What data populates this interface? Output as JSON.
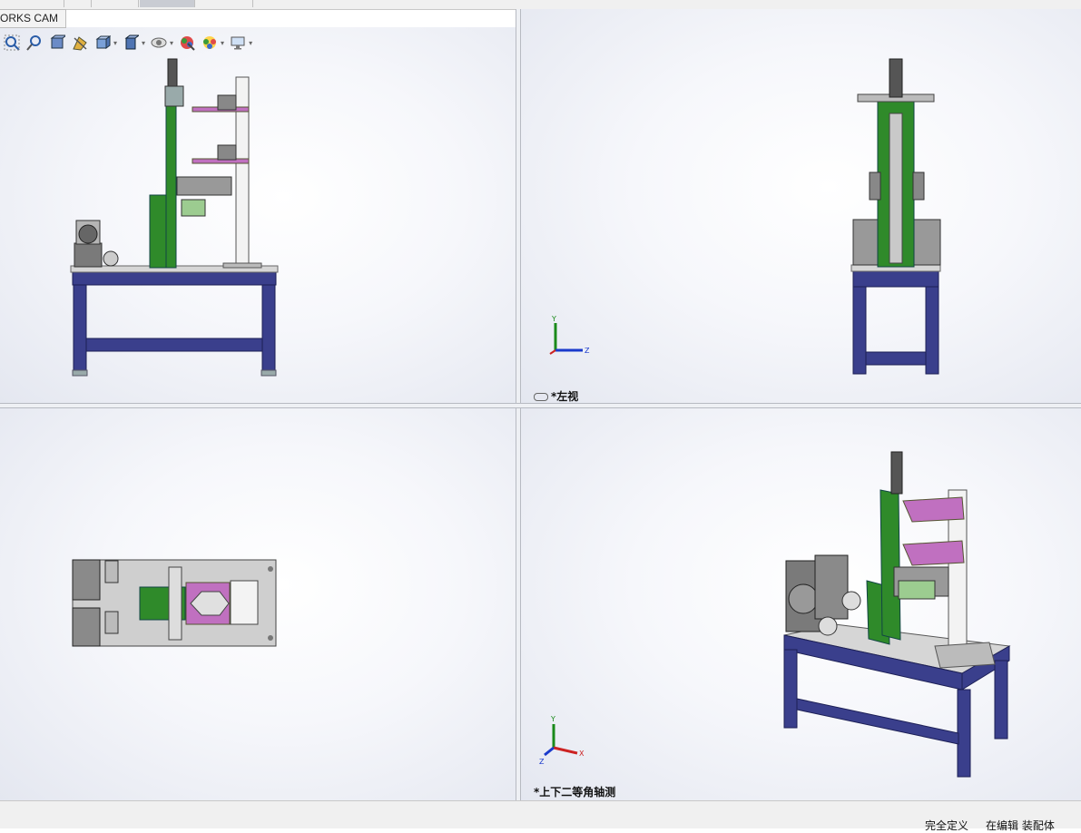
{
  "window": {
    "tab_label": "ORKS CAM"
  },
  "toolbar": {
    "items": [
      {
        "icon": "zoom-to-fit-icon"
      },
      {
        "icon": "zoom-area-icon"
      },
      {
        "icon": "previous-view-icon"
      },
      {
        "icon": "section-view-icon"
      },
      {
        "icon": "view-orientation-icon"
      },
      {
        "icon": "display-style-icon"
      },
      {
        "icon": "hide-show-items-icon"
      },
      {
        "icon": "edit-appearance-icon"
      },
      {
        "icon": "apply-scene-icon"
      },
      {
        "icon": "view-settings-icon"
      }
    ]
  },
  "viewports": {
    "top_left": {
      "view": "front"
    },
    "top_right": {
      "label": "*左视",
      "triad": {
        "y": "Y",
        "z": "Z"
      }
    },
    "bottom_left": {
      "view": "top"
    },
    "bottom_right": {
      "label": "*上下二等角轴测",
      "triad": {
        "y": "Y",
        "x": "X",
        "z": "Z"
      }
    }
  },
  "status": {
    "definition": "完全定义",
    "mode": "在编辑 装配体"
  },
  "colors": {
    "frame_navy": "#3a3f8c",
    "column_green": "#2f8a2a",
    "fixture_pink": "#c070c0",
    "motor_grey": "#7a7a7a",
    "table_top_grey": "#d6d6d6"
  }
}
